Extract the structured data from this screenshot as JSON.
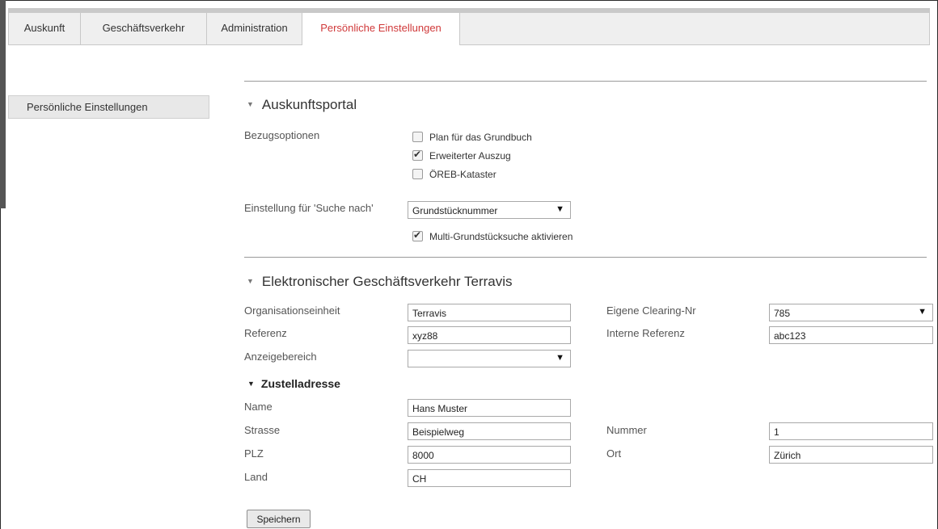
{
  "tabs": [
    {
      "label": "Auskunft"
    },
    {
      "label": "Geschäftsverkehr"
    },
    {
      "label": "Administration"
    },
    {
      "label": "Persönliche Einstellungen",
      "active": true
    }
  ],
  "sidebar": {
    "items": [
      {
        "label": "Persönliche Einstellungen"
      }
    ]
  },
  "auskunftsportal": {
    "title": "Auskunftsportal",
    "bezugsoptionen_label": "Bezugsoptionen",
    "options": [
      {
        "label": "Plan für das Grundbuch",
        "checked": false
      },
      {
        "label": "Erweiterter Auszug",
        "checked": true
      },
      {
        "label": "ÖREB-Kataster",
        "checked": false
      }
    ],
    "suche_label": "Einstellung für 'Suche nach'",
    "suche_value": "Grundstücknummer",
    "multi_label": "Multi-Grundstücksuche aktivieren",
    "multi_checked": true
  },
  "terravis": {
    "title": "Elektronischer Geschäftsverkehr Terravis",
    "org_label": "Organisationseinheit",
    "org_value": "Terravis",
    "clearing_label": "Eigene Clearing-Nr",
    "clearing_value": "785",
    "referenz_label": "Referenz",
    "referenz_value": "xyz88",
    "interne_label": "Interne Referenz",
    "interne_value": "abc123",
    "anzeige_label": "Anzeigebereich",
    "anzeige_value": ""
  },
  "zustelladresse": {
    "title": "Zustelladresse",
    "name_label": "Name",
    "name_value": "Hans Muster",
    "strasse_label": "Strasse",
    "strasse_value": "Beispielweg",
    "nummer_label": "Nummer",
    "nummer_value": "1",
    "plz_label": "PLZ",
    "plz_value": "8000",
    "ort_label": "Ort",
    "ort_value": "Zürich",
    "land_label": "Land",
    "land_value": "CH"
  },
  "save_label": "Speichern",
  "colors": {
    "active_tab": "#d0393a",
    "tabbar_bg": "#efefef",
    "sidebar_bg": "#e8e8e8"
  }
}
